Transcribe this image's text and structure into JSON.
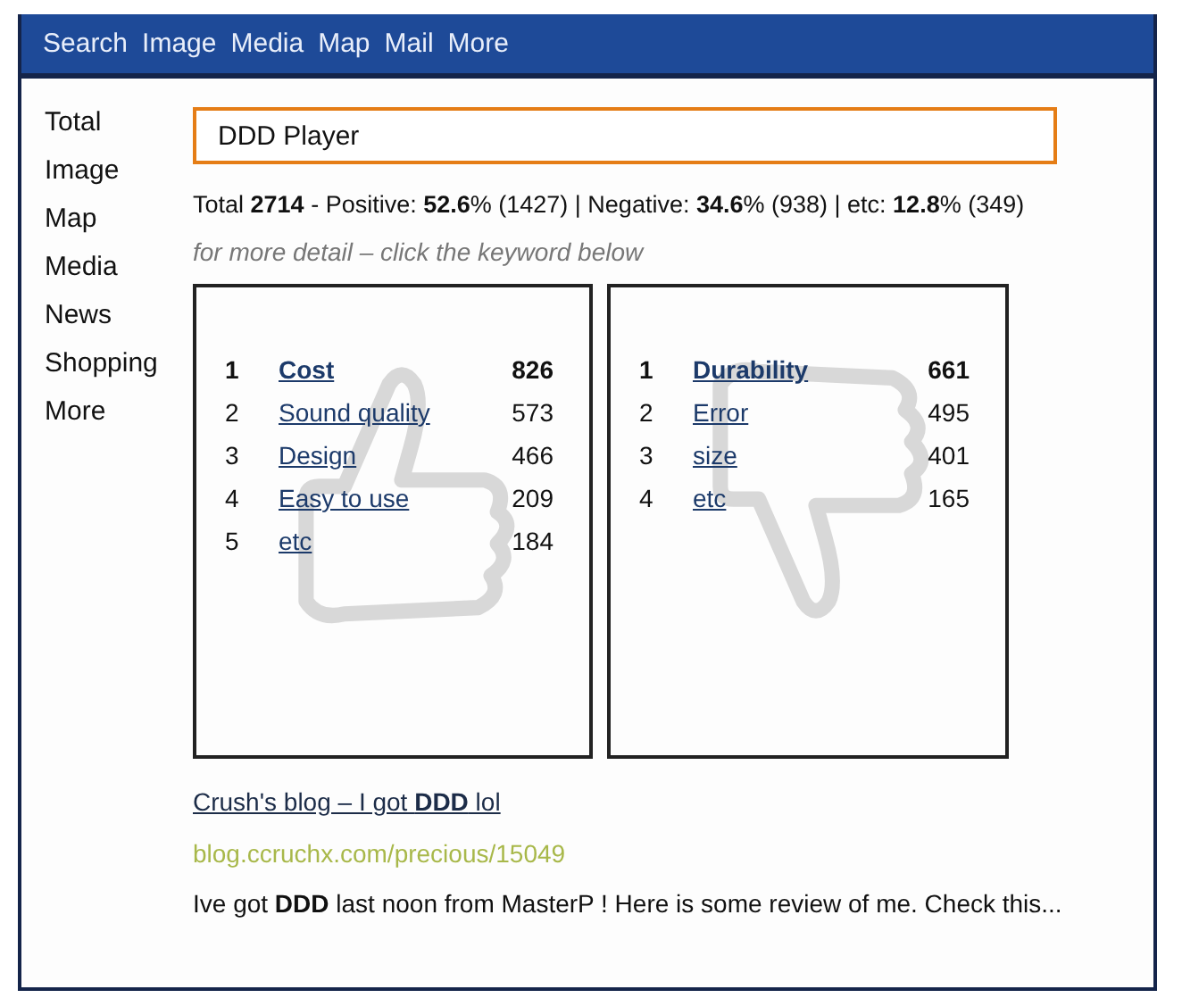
{
  "top_nav": [
    {
      "label": "Search"
    },
    {
      "label": "Image"
    },
    {
      "label": "Media"
    },
    {
      "label": "Map"
    },
    {
      "label": "Mail"
    },
    {
      "label": "More"
    }
  ],
  "sidebar": {
    "items": [
      {
        "label": "Total"
      },
      {
        "label": "Image"
      },
      {
        "label": "Map"
      },
      {
        "label": "Media"
      },
      {
        "label": "News"
      },
      {
        "label": "Shopping"
      },
      {
        "label": "More"
      }
    ]
  },
  "search": {
    "value": "DDD Player"
  },
  "summary": "Total **2714** - Positive: **52.6**% (1427) | Negative: **34.6**% (938) | etc: **12.8**% (349)",
  "hint": "for more detail – click the keyword below",
  "panels": [
    {
      "kind": "positive",
      "rows": [
        {
          "rank": "1",
          "keyword": "Cost",
          "count": "826",
          "bold": true
        },
        {
          "rank": "2",
          "keyword": "Sound quality",
          "count": "573",
          "bold": false
        },
        {
          "rank": "3",
          "keyword": "Design",
          "count": "466",
          "bold": false
        },
        {
          "rank": "4",
          "keyword": "Easy to use",
          "count": "209",
          "bold": false
        },
        {
          "rank": "5",
          "keyword": "etc",
          "count": "184",
          "bold": false
        }
      ]
    },
    {
      "kind": "negative",
      "rows": [
        {
          "rank": "1",
          "keyword": "Durability",
          "count": "661",
          "bold": true
        },
        {
          "rank": "2",
          "keyword": "Error",
          "count": "495",
          "bold": false
        },
        {
          "rank": "3",
          "keyword": "size",
          "count": "401",
          "bold": false
        },
        {
          "rank": "4",
          "keyword": "etc",
          "count": "165",
          "bold": false
        }
      ]
    }
  ],
  "result": {
    "title": "Crush's blog – I got **DDD** lol",
    "url": "blog.ccruchx.com/precious/15049",
    "snippet": "Ive got **DDD** last noon from MasterP ! Here is some review of me. Check this..."
  }
}
